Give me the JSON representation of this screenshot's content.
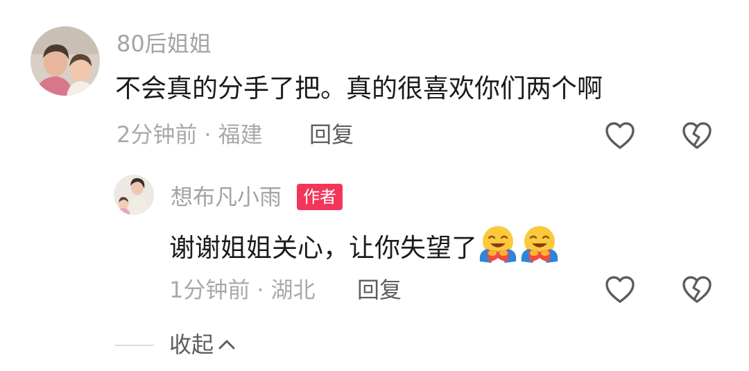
{
  "comment": {
    "username": "80后姐姐",
    "text": "不会真的分手了把。真的很喜欢你们两个啊",
    "time": "2分钟前",
    "separator": "·",
    "location": "福建",
    "reply_label": "回复",
    "avatar_icon": "user-avatar-photo",
    "like_icon": "heart-outline-icon",
    "dislike_icon": "broken-heart-icon"
  },
  "reply": {
    "username": "想布凡小雨",
    "badge": "作者",
    "text": "谢谢姐姐关心，让你失望了",
    "emoji_icon": "hugging-face-emoji",
    "emoji_count": 2,
    "time": "1分钟前",
    "separator": "·",
    "location": "湖北",
    "reply_label": "回复",
    "avatar_icon": "user-avatar-photo",
    "like_icon": "heart-outline-icon",
    "dislike_icon": "broken-heart-icon"
  },
  "collapse": {
    "label": "收起",
    "icon": "chevron-up-icon"
  },
  "colors": {
    "badge_bg": "#f2365a",
    "username": "#a3a3a3",
    "text": "#1b1b1b",
    "meta": "#a9a9a9",
    "action": "#5c5c5c"
  }
}
